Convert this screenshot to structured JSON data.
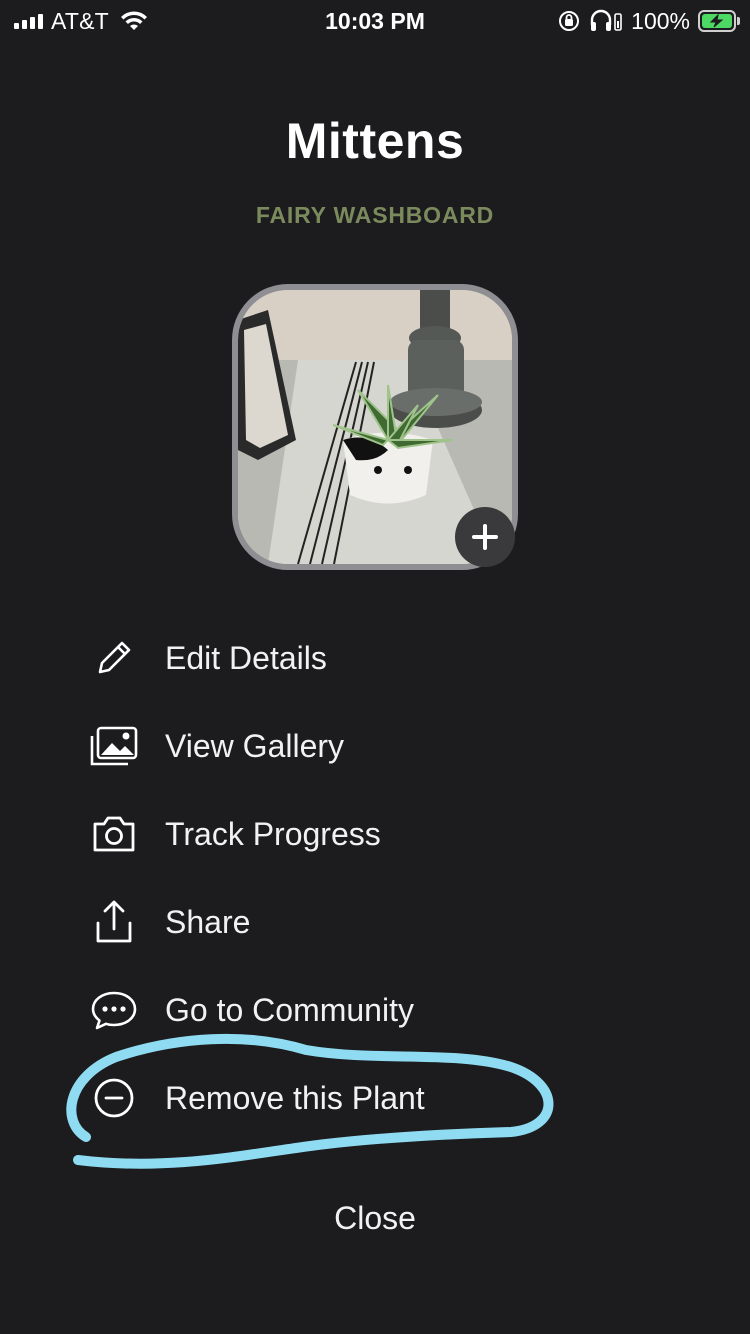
{
  "status_bar": {
    "carrier": "AT&T",
    "time": "10:03 PM",
    "battery": "100%",
    "icons": [
      "signal-icon",
      "wifi-icon",
      "orientation-lock-icon",
      "headphones-icon",
      "battery-charging-icon"
    ]
  },
  "plant": {
    "name": "Mittens",
    "species": "FAIRY WASHBOARD",
    "photo_description_icon": "plant-photo",
    "add_photo_icon": "plus-icon"
  },
  "menu": {
    "items": [
      {
        "label": "Edit Details",
        "icon": "pencil-icon"
      },
      {
        "label": "View Gallery",
        "icon": "gallery-icon"
      },
      {
        "label": "Track Progress",
        "icon": "camera-icon"
      },
      {
        "label": "Share",
        "icon": "share-icon"
      },
      {
        "label": "Go to Community",
        "icon": "chat-bubble-icon"
      },
      {
        "label": "Remove this Plant",
        "icon": "minus-circle-icon"
      }
    ]
  },
  "close_label": "Close",
  "colors": {
    "background": "#1c1c1e",
    "species_text": "#7b8a5d",
    "highlight_scribble": "#8fdcf2",
    "photo_border": "#8e8e93"
  }
}
